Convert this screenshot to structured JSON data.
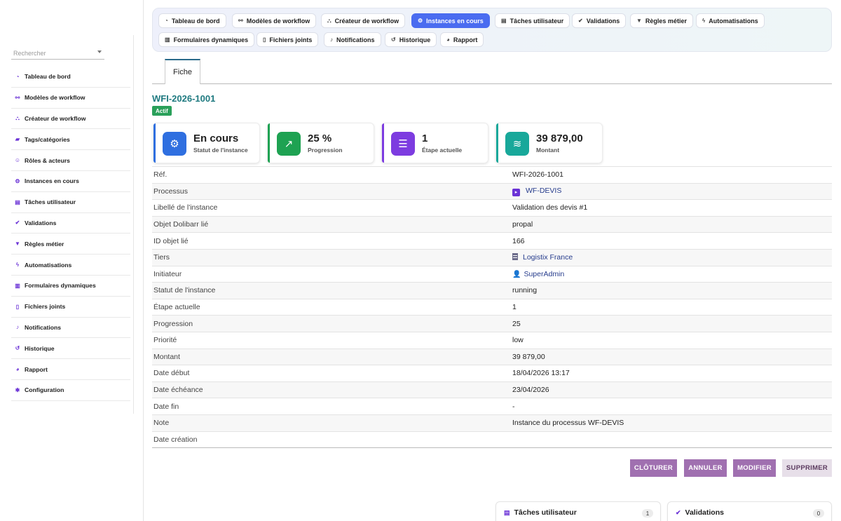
{
  "sidebar": {
    "search_placeholder": "Rechercher",
    "items": [
      {
        "label": "Tableau de bord",
        "icon": "◔"
      },
      {
        "label": "Modèles de workflow",
        "icon": "⚯"
      },
      {
        "label": "Créateur de workflow",
        "icon": "⛬"
      },
      {
        "label": "Tags/catégories",
        "icon": "▰"
      },
      {
        "label": "Rôles & acteurs",
        "icon": "☺"
      },
      {
        "label": "Instances en cours",
        "icon": "⚙"
      },
      {
        "label": "Tâches utilisateur",
        "icon": "▤"
      },
      {
        "label": "Validations",
        "icon": "✔"
      },
      {
        "label": "Règles métier",
        "icon": "▼"
      },
      {
        "label": "Automatisations",
        "icon": "ϟ"
      },
      {
        "label": "Formulaires dynamiques",
        "icon": "▥"
      },
      {
        "label": "Fichiers joints",
        "icon": "▯"
      },
      {
        "label": "Notifications",
        "icon": "♪"
      },
      {
        "label": "Historique",
        "icon": "↺"
      },
      {
        "label": "Rapport",
        "icon": "◕"
      },
      {
        "label": "Configuration",
        "icon": "✱"
      }
    ]
  },
  "topnav": {
    "row1": [
      {
        "label": "Tableau de bord",
        "icon": "◔"
      },
      {
        "label": "Modèles de workflow",
        "icon": "⚯"
      },
      {
        "label": "Créateur de workflow",
        "icon": "⛬"
      },
      {
        "label": "Instances en cours",
        "icon": "⚙",
        "active": true
      },
      {
        "label": "Tâches utilisateur",
        "icon": "▤"
      },
      {
        "label": "Validations",
        "icon": "✔"
      },
      {
        "label": "Règles métier",
        "icon": "▼"
      },
      {
        "label": "Automatisations",
        "icon": "ϟ"
      }
    ],
    "row2": [
      {
        "label": "Formulaires dynamiques",
        "icon": "▥"
      },
      {
        "label": "Fichiers joints",
        "icon": "▯"
      },
      {
        "label": "Notifications",
        "icon": "♪"
      },
      {
        "label": "Historique",
        "icon": "↺"
      },
      {
        "label": "Rapport",
        "icon": "◕"
      }
    ]
  },
  "tab": {
    "label": "Fiche"
  },
  "record": {
    "ref": "WFI-2026-1001",
    "status_badge": "Actif"
  },
  "kpis": [
    {
      "value": "En cours",
      "label": "Statut de l'instance",
      "color": "#2f6fe0",
      "icon": "⚙"
    },
    {
      "value": "25 %",
      "label": "Progression",
      "color": "#1ea252",
      "icon": "↗"
    },
    {
      "value": "1",
      "label": "Étape actuelle",
      "color": "#7d3ce0",
      "icon": "☰"
    },
    {
      "value": "39 879,00",
      "label": "Montant",
      "color": "#18a89a",
      "icon": "≋"
    }
  ],
  "fields": {
    "ref": {
      "label": "Réf.",
      "value": "WFI-2026-1001"
    },
    "processus": {
      "label": "Processus",
      "value": "WF-DEVIS"
    },
    "libelle": {
      "label": "Libellé de l'instance",
      "value": "Validation des devis #1"
    },
    "objet": {
      "label": "Objet Dolibarr lié",
      "value": "propal"
    },
    "id_objet": {
      "label": "ID objet lié",
      "value": "166"
    },
    "tiers": {
      "label": "Tiers",
      "value": "Logistix France"
    },
    "initiateur": {
      "label": "Initiateur",
      "value": "SuperAdmin"
    },
    "statut": {
      "label": "Statut de l'instance",
      "value": "running"
    },
    "etape": {
      "label": "Étape actuelle",
      "value": "1"
    },
    "progression": {
      "label": "Progression",
      "value": "25"
    },
    "priorite": {
      "label": "Priorité",
      "value": "low"
    },
    "montant": {
      "label": "Montant",
      "value": "39 879,00"
    },
    "date_debut": {
      "label": "Date début",
      "value": "18/04/2026 13:17"
    },
    "date_echeance": {
      "label": "Date échéance",
      "value": "23/04/2026"
    },
    "date_fin": {
      "label": "Date fin",
      "value": "-"
    },
    "note": {
      "label": "Note",
      "value": "Instance du processus WF-DEVIS"
    },
    "date_creation": {
      "label": "Date création",
      "value": ""
    }
  },
  "actions": {
    "cloturer": "CLÔTURER",
    "annuler": "ANNULER",
    "modifier": "MODIFIER",
    "supprimer": "SUPPRIMER"
  },
  "widgets": {
    "taches": {
      "title": "Tâches utilisateur",
      "count": "1"
    },
    "validations": {
      "title": "Validations",
      "count": "0"
    }
  },
  "colors": {
    "accent": "#4a6cf0",
    "brand_purple": "#6b33d6",
    "teal": "#1f7a80",
    "button_purple": "#a070b0"
  }
}
